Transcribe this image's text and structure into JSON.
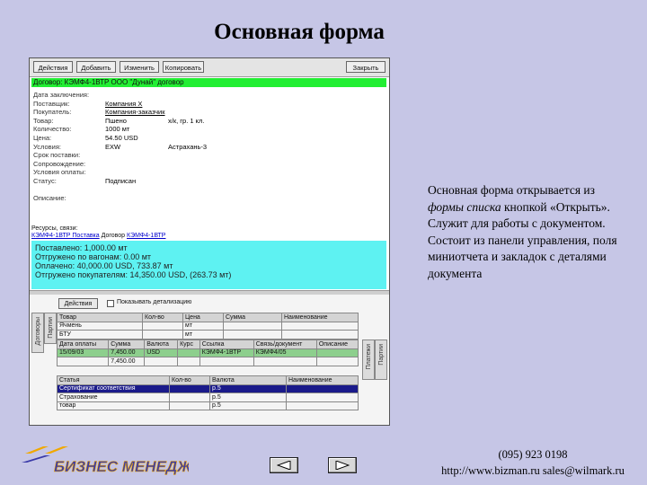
{
  "title": "Основная форма",
  "description": {
    "line_start": "Основная форма открывается из ",
    "italic": "формы списка",
    "line_end": " кнопкой «Открыть». Служит для работы с документом. Состоит из панели управления, поля миниотчета и закладок с деталями документа"
  },
  "contact": {
    "phone": "(095) 923 0198",
    "web": "http://www.bizman.ru  sales@wilmark.ru"
  },
  "logo": {
    "text": "БИЗНЕС МЕНЕДЖЕР"
  },
  "nav": {
    "prev": "left-triangle-icon",
    "next": "right-triangle-icon"
  },
  "window": {
    "toolbar": [
      "Действия",
      "Добавить",
      "Изменить",
      "Копировать",
      "Закрыть"
    ],
    "green_bar": "Договор:    КЭМФ4-1ВТР        ООО \"Дунай\" договор",
    "fields": [
      {
        "label": "Дата заключения:",
        "value": "",
        "value2": ""
      },
      {
        "label": "Поставщик:",
        "value": "Компания X",
        "value2": "",
        "link": true
      },
      {
        "label": "Покупатель:",
        "value": "Компания-заказчик",
        "value2": "",
        "link": true
      },
      {
        "label": "Товар:",
        "value": "Пшено",
        "value2": "х/к, гр. 1 кл.",
        "link": false
      },
      {
        "label": "Количество:",
        "value": "1000 мт",
        "value2": ""
      },
      {
        "label": "Цена:",
        "value": "54.50 USD",
        "value2": ""
      },
      {
        "label": "Условия:",
        "value": "EXW",
        "value2": "Астрахань-3"
      },
      {
        "label": "Срок поставки:",
        "value": "",
        "value2": ""
      },
      {
        "label": "Сопровождение:",
        "value": "",
        "value2": ""
      },
      {
        "label": "Условия оплаты:",
        "value": "",
        "value2": ""
      },
      {
        "label": "Статус:",
        "value": "Подписан",
        "value2": ""
      },
      {
        "label": "",
        "value": "",
        "value2": ""
      },
      {
        "label": "Описание:",
        "value": "",
        "value2": ""
      }
    ],
    "link_row": {
      "label": "Ресурсы, связи:",
      "link1": "КЭМФ4-1ВТР Поставка",
      "text": "Договор",
      "link2": "КЭМФ4-1ВТР"
    },
    "report_lines": [
      "Поставлено: 1,000.00 мт",
      "Отгружено по вагонам: 0.00 мт",
      "Оплачено: 40,000.00 USD, 733.87 мт",
      "Отгружено покупателям: 14,350.00 USD, (263.73 мт)"
    ],
    "grid_toolbar": {
      "action": "Действия",
      "checkbox_label": "Показывать детализацию"
    },
    "left_tabs": [
      "Договоры",
      "Партии"
    ],
    "right_tabs": [
      "Платежи",
      "Партии"
    ],
    "table1": {
      "headers": [
        "Товар",
        "Кол-во",
        "Цена",
        "Сумма",
        "Наименование"
      ],
      "rows": [
        [
          "Ячмень",
          "",
          "мт",
          "",
          ""
        ],
        [
          "БТУ",
          "",
          "мт",
          "",
          ""
        ]
      ]
    },
    "table2": {
      "headers": [
        "Дата оплаты",
        "Сумма",
        "Валюта",
        "Курс",
        "Ссылка",
        "Связь/документ",
        "Описание"
      ],
      "rows": [
        [
          "15/09/03",
          "7,450.00",
          "USD",
          "",
          "КЭМФ4-1ВТР",
          "КЭМФ4/05",
          ""
        ],
        [
          "",
          "7,450.00",
          "",
          "",
          "",
          "",
          ""
        ]
      ]
    },
    "table3": {
      "headers": [
        "Статья",
        "Кол-во",
        "Валюта",
        "Наименование"
      ],
      "rows": [
        [
          "Сертификат соответствия",
          "",
          "р.5",
          ""
        ],
        [
          "Страхование",
          "",
          "р.5",
          ""
        ],
        [
          "товар",
          "",
          "р.5",
          ""
        ]
      ]
    }
  }
}
